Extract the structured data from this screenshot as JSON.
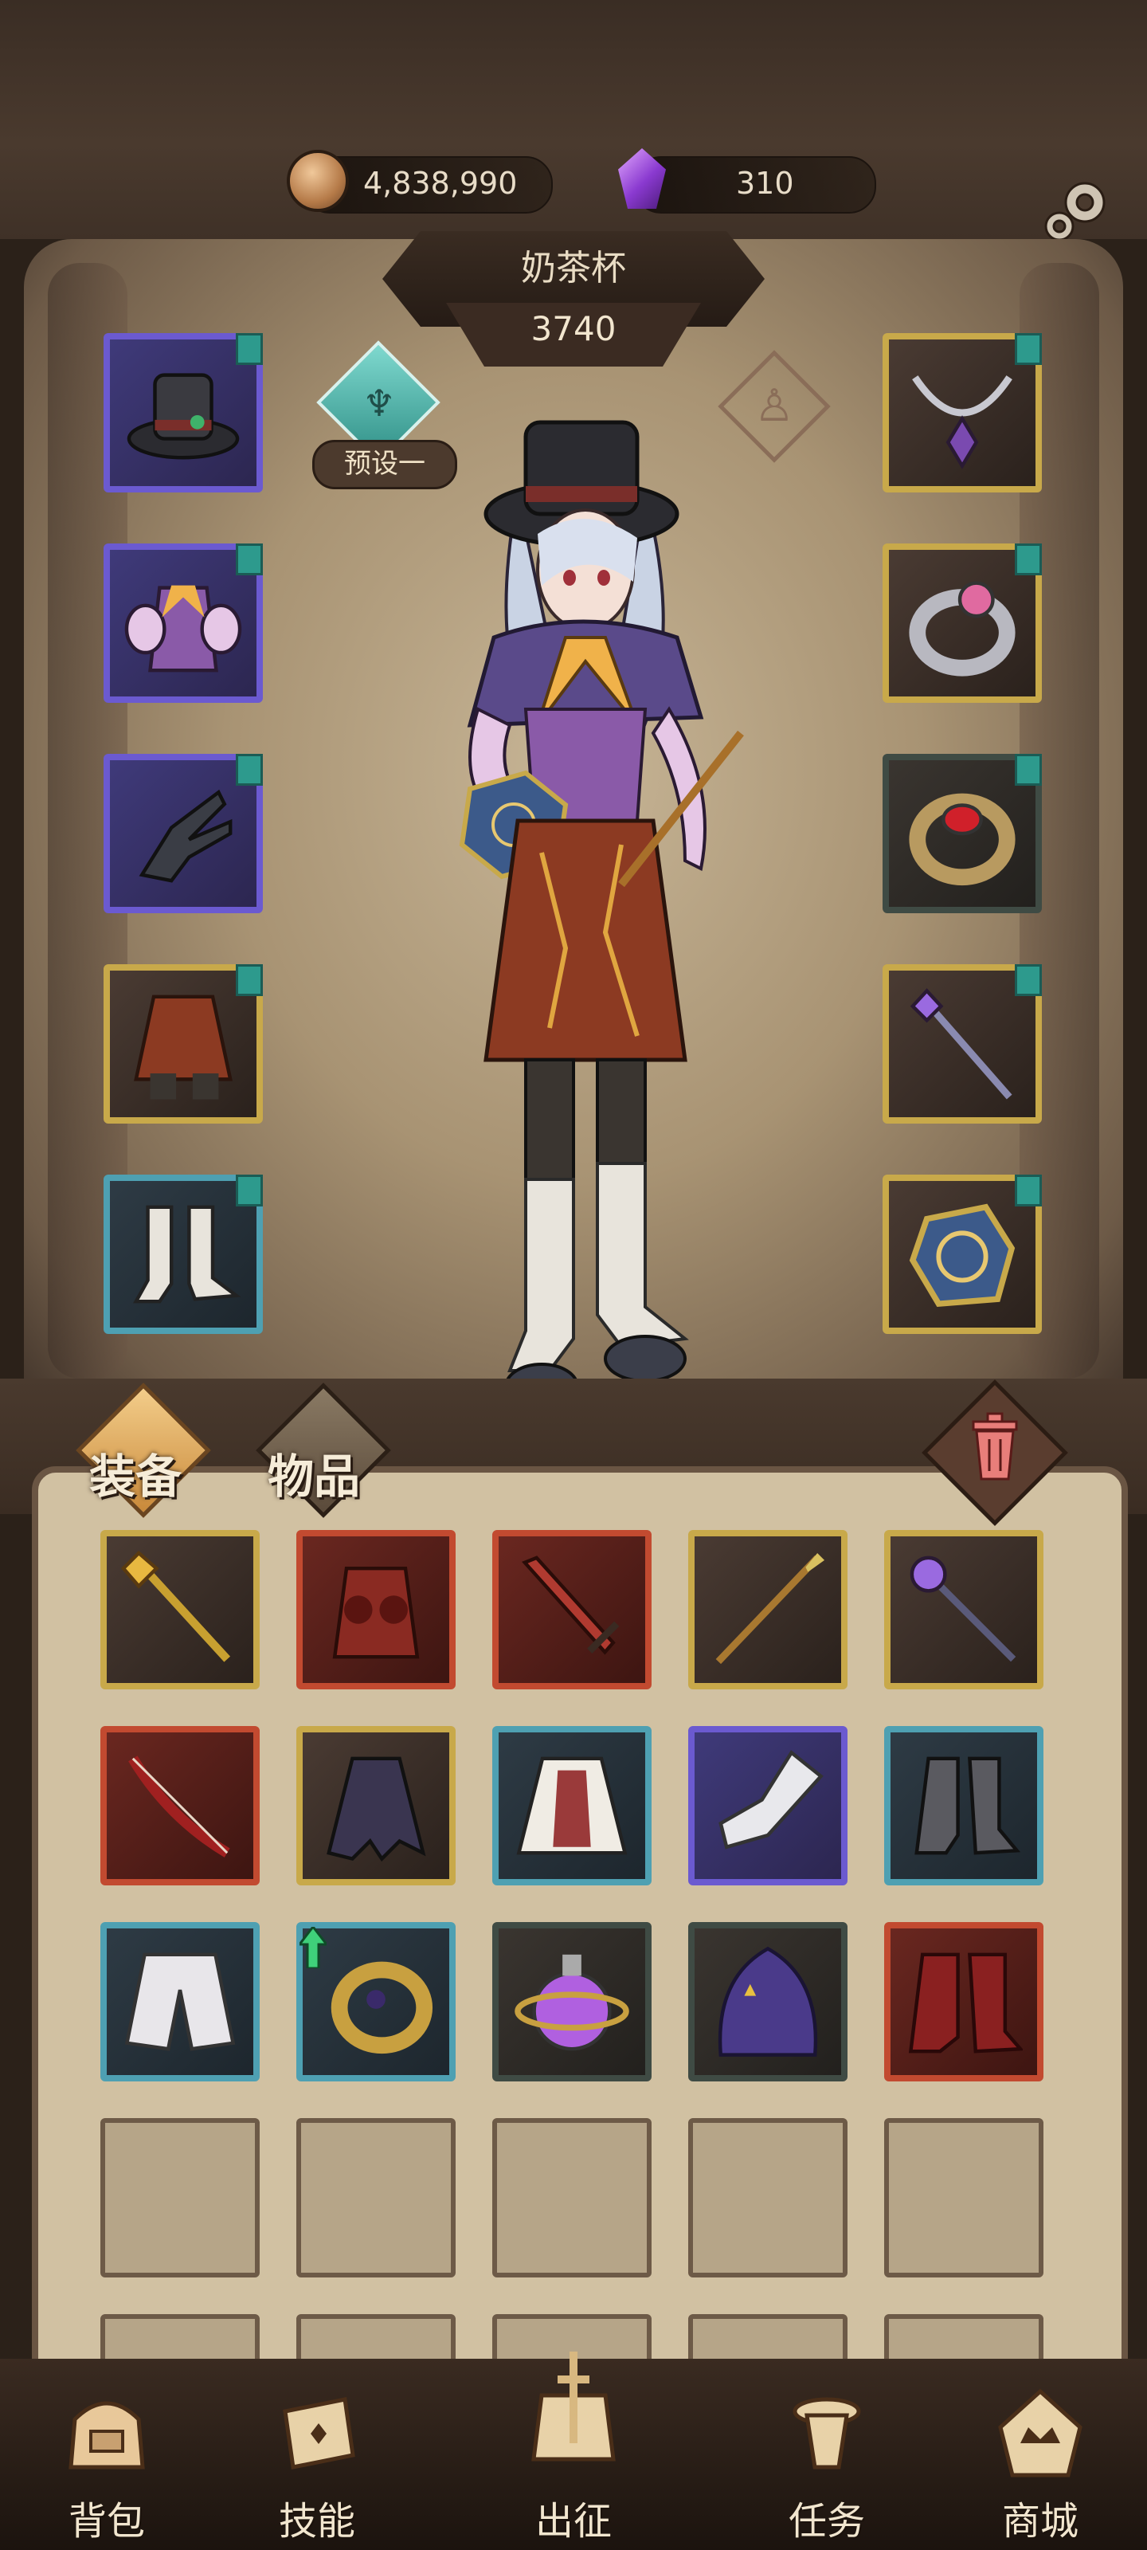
{
  "currency": {
    "coins": "4,838,990",
    "gems": "310"
  },
  "character": {
    "name": "奶茶杯",
    "power": "3740",
    "preset_label": "预设一"
  },
  "equipment_left": [
    {
      "slot": "hat",
      "icon": "top-hat-icon",
      "rarity": "purple"
    },
    {
      "slot": "armor",
      "icon": "puff-dress-icon",
      "rarity": "purple"
    },
    {
      "slot": "gloves",
      "icon": "claw-glove-icon",
      "rarity": "purple"
    },
    {
      "slot": "legs",
      "icon": "red-skirt-icon",
      "rarity": "gold"
    },
    {
      "slot": "boots",
      "icon": "white-boots-icon",
      "rarity": "blue"
    }
  ],
  "equipment_right": [
    {
      "slot": "necklace",
      "icon": "crystal-necklace-icon",
      "rarity": "gold"
    },
    {
      "slot": "ring1",
      "icon": "silver-ring-icon",
      "rarity": "gold"
    },
    {
      "slot": "ring2",
      "icon": "ruby-ring-icon",
      "rarity": "dark"
    },
    {
      "slot": "weapon",
      "icon": "crystal-staff-icon",
      "rarity": "gold"
    },
    {
      "slot": "offhand",
      "icon": "rune-tome-icon",
      "rarity": "gold"
    }
  ],
  "tabs": {
    "equipment": "装备",
    "items": "物品"
  },
  "inventory": [
    {
      "icon": "golden-staff-icon",
      "rarity": "gold"
    },
    {
      "icon": "demon-armor-icon",
      "rarity": "red"
    },
    {
      "icon": "crimson-sword-icon",
      "rarity": "red"
    },
    {
      "icon": "long-spear-icon",
      "rarity": "gold"
    },
    {
      "icon": "orb-scepter-icon",
      "rarity": "gold"
    },
    {
      "icon": "bone-bow-icon",
      "rarity": "red"
    },
    {
      "icon": "ragged-cloak-icon",
      "rarity": "gold"
    },
    {
      "icon": "corset-coat-icon",
      "rarity": "blue"
    },
    {
      "icon": "white-gauntlet-icon",
      "rarity": "purple"
    },
    {
      "icon": "grey-boots-icon",
      "rarity": "blue"
    },
    {
      "icon": "white-pants-icon",
      "rarity": "blue"
    },
    {
      "icon": "gold-ring-icon",
      "rarity": "blue",
      "upgrade": true
    },
    {
      "icon": "potion-orb-icon",
      "rarity": "dark"
    },
    {
      "icon": "wizard-hood-icon",
      "rarity": "dark"
    },
    {
      "icon": "red-boots-icon",
      "rarity": "red"
    }
  ],
  "empty_slots": 10,
  "nav": {
    "backpack": "背包",
    "skills": "技能",
    "expedition": "出征",
    "quests": "任务",
    "shop": "商城"
  },
  "colors": {
    "rarity_purple": "#6b5ad0",
    "rarity_gold": "#c8a94a",
    "rarity_blue": "#4ea0b2",
    "rarity_red": "#c24a30",
    "rarity_dark": "#3f4b44",
    "badge_teal": "#2d9a8d"
  }
}
